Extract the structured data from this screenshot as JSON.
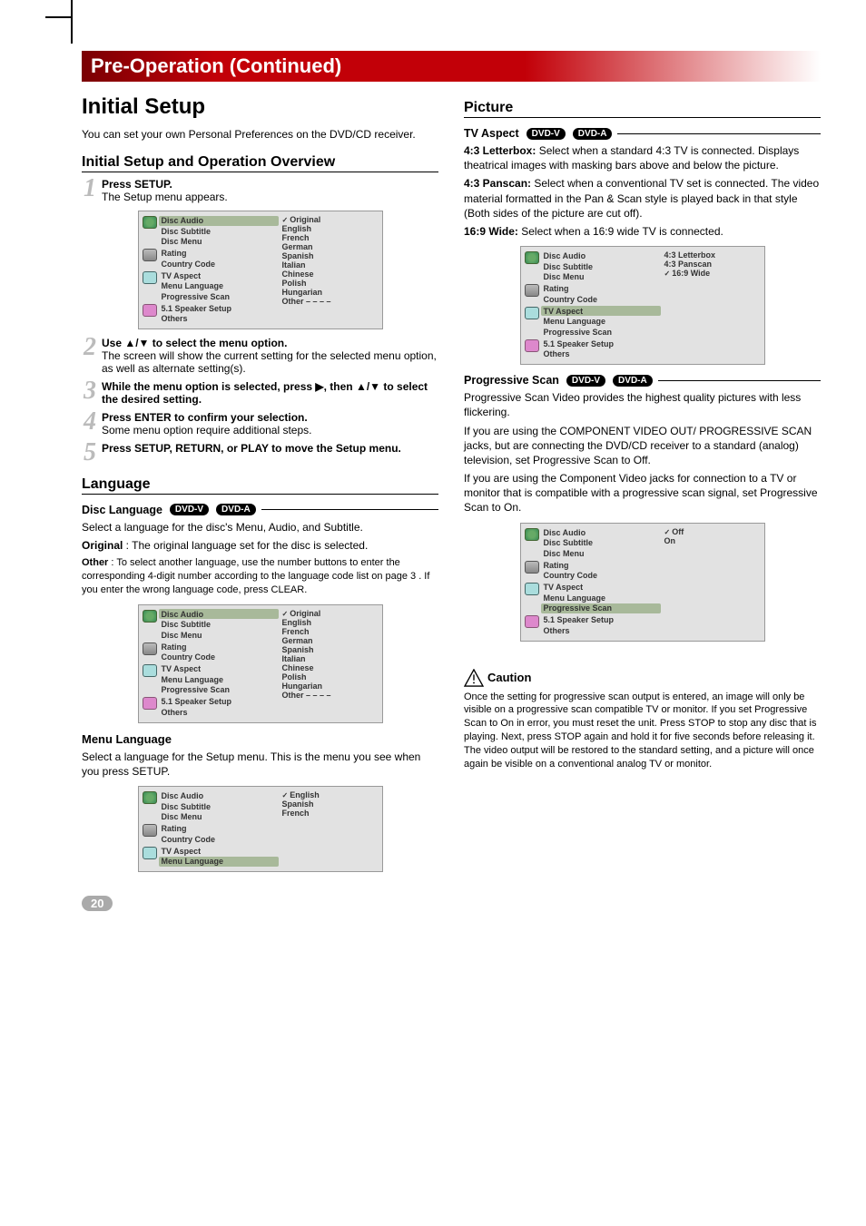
{
  "banner": "Pre-Operation (Continued)",
  "page_number": "20",
  "left": {
    "h1": "Initial Setup",
    "intro": "You can set your own Personal Preferences on the DVD/CD receiver.",
    "h2_overview": "Initial Setup and Operation Overview",
    "step1_b": "Press SETUP.",
    "step1_t": "The Setup menu appears.",
    "step2_b": "Use ▲/▼ to select the menu option.",
    "step2_t": "The screen will show the current setting for the selected menu option, as well as alternate setting(s).",
    "step3_b": "While the menu option is selected, press ▶, then ▲/▼ to select the desired setting.",
    "step4_b": "Press ENTER to confirm your selection.",
    "step4_t": "Some menu option require additional steps.",
    "step5_b": "Press SETUP, RETURN, or PLAY to move the Setup menu.",
    "h2_lang": "Language",
    "disc_lang_h": "Disc Language",
    "disc_lang_p": "Select a language for the disc's Menu, Audio, and Subtitle.",
    "original_b": "Original",
    "original_t": " : The original language set for the disc is selected.",
    "other_b": "Other",
    "other_t": " : To select another language, use the number buttons to enter the corresponding 4-digit number according to the language code list on page 3 . If you enter the wrong language code, press CLEAR.",
    "menu_lang_h": "Menu Language",
    "menu_lang_p": "Select a language for the Setup menu. This is the menu you see when you press SETUP."
  },
  "right": {
    "h2_pic": "Picture",
    "tv_h": "TV Aspect",
    "tv_43lb_b": "4:3 Letterbox:",
    "tv_43lb_t": " Select when a standard 4:3 TV is connected. Displays theatrical images with masking bars above and below the picture.",
    "tv_43ps_b": "4:3 Panscan:",
    "tv_43ps_t": " Select when a conventional TV set is connected. The video material formatted in the Pan & Scan style is played back in that style (Both sides of the picture are cut off).",
    "tv_169_b": "16:9 Wide:",
    "tv_169_t": " Select when a 16:9 wide TV is connected.",
    "ps_h": "Progressive Scan",
    "ps_p1": "Progressive Scan Video provides the highest quality pictures with less flickering.",
    "ps_p2": "If you are using the COMPONENT VIDEO OUT/ PROGRESSIVE SCAN jacks, but are connecting the DVD/CD receiver to a standard (analog) television, set Progressive Scan to Off.",
    "ps_p3": "If you are using the Component Video jacks for connection to a TV or monitor that is compatible with a progressive scan signal, set Progressive Scan to On.",
    "caution_h": "Caution",
    "caution_t": "Once the setting for progressive scan output is entered, an image will only be visible on a progressive scan compatible TV or monitor. If you set Progressive Scan to On in error, you must reset the unit. Press STOP to stop any disc that is playing. Next, press STOP again and hold it for five seconds before releasing it. The video output will be restored to the standard setting, and a picture will once again be visible on a conventional analog TV or monitor."
  },
  "pills": {
    "dvdv": "DVD-V",
    "dvda": "DVD-A"
  },
  "osd_common_left": [
    {
      "icon": "globe",
      "items": [
        {
          "t": "Disc Audio",
          "hl": true
        },
        {
          "t": "Disc Subtitle"
        },
        {
          "t": "Disc Menu"
        }
      ]
    },
    {
      "icon": "lock",
      "items": [
        {
          "t": "Rating"
        },
        {
          "t": "Country Code"
        }
      ]
    },
    {
      "icon": "tv",
      "items": [
        {
          "t": "TV Aspect"
        },
        {
          "t": "Menu Language"
        },
        {
          "t": "Progressive Scan"
        }
      ]
    },
    {
      "icon": "spk",
      "items": [
        {
          "t": "5.1 Speaker Setup"
        },
        {
          "t": "Others"
        }
      ]
    }
  ],
  "osd1_right": [
    "Original",
    "English",
    "French",
    "German",
    "Spanish",
    "Italian",
    "Chinese",
    "Polish",
    "Hungarian",
    "Other  – – – –"
  ],
  "osd_tv_left": [
    {
      "icon": "globe",
      "items": [
        {
          "t": "Disc Audio"
        },
        {
          "t": "Disc Subtitle"
        },
        {
          "t": "Disc Menu"
        }
      ]
    },
    {
      "icon": "lock",
      "items": [
        {
          "t": "Rating"
        },
        {
          "t": "Country Code"
        }
      ]
    },
    {
      "icon": "tv",
      "items": [
        {
          "t": "TV Aspect",
          "hl": true
        },
        {
          "t": "Menu Language"
        },
        {
          "t": "Progressive Scan"
        }
      ]
    },
    {
      "icon": "spk",
      "items": [
        {
          "t": "5.1 Speaker Setup"
        },
        {
          "t": "Others"
        }
      ]
    }
  ],
  "osd_tv_right": [
    "4:3  Letterbox",
    "4:3  Panscan",
    "16:9 Wide"
  ],
  "osd_ml_left": [
    {
      "icon": "globe",
      "items": [
        {
          "t": "Disc Audio"
        },
        {
          "t": "Disc Subtitle"
        },
        {
          "t": "Disc Menu"
        }
      ]
    },
    {
      "icon": "lock",
      "items": [
        {
          "t": "Rating"
        },
        {
          "t": "Country Code"
        }
      ]
    },
    {
      "icon": "tv",
      "items": [
        {
          "t": "TV Aspect"
        },
        {
          "t": "Menu Language",
          "hl": true
        }
      ]
    }
  ],
  "osd_ml_right": [
    "English",
    "Spanish",
    "French"
  ],
  "osd_ps_left": [
    {
      "icon": "globe",
      "items": [
        {
          "t": "Disc Audio"
        },
        {
          "t": "Disc Subtitle"
        },
        {
          "t": "Disc Menu"
        }
      ]
    },
    {
      "icon": "lock",
      "items": [
        {
          "t": "Rating"
        },
        {
          "t": "Country Code"
        }
      ]
    },
    {
      "icon": "tv",
      "items": [
        {
          "t": "TV Aspect"
        },
        {
          "t": "Menu Language"
        },
        {
          "t": "Progressive Scan",
          "hl": true
        }
      ]
    },
    {
      "icon": "spk",
      "items": [
        {
          "t": "5.1 Speaker Setup"
        },
        {
          "t": "Others"
        }
      ]
    }
  ],
  "osd_ps_right": [
    "Off",
    "On"
  ]
}
